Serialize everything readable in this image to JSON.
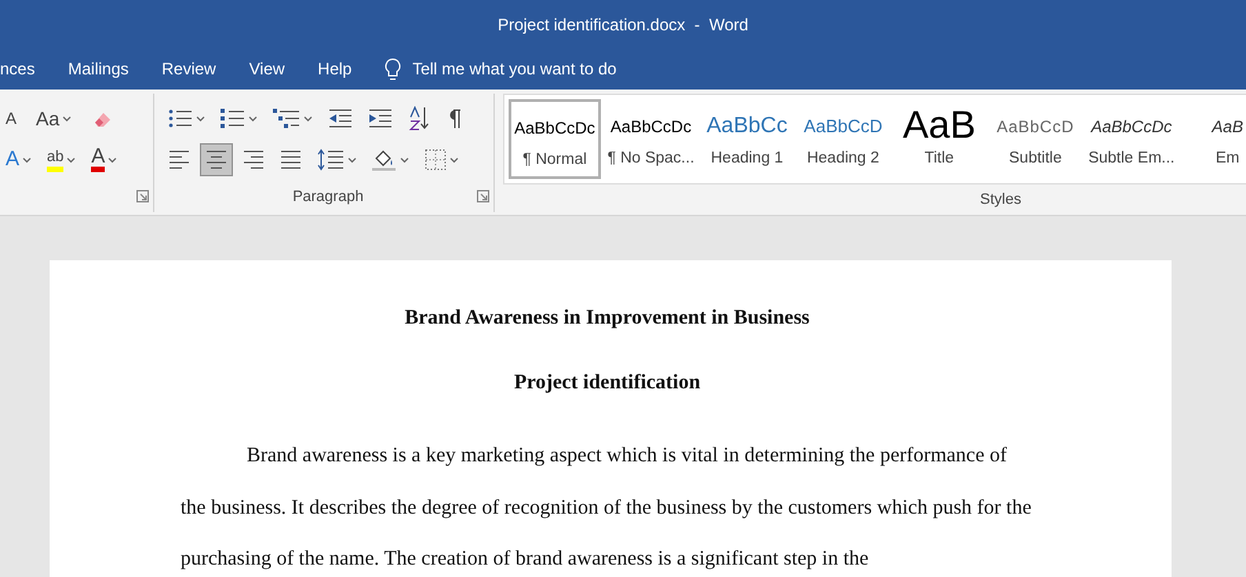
{
  "window": {
    "title": "Project identification.docx  -  Word"
  },
  "ribbon_tabs": [
    {
      "label": "nces"
    },
    {
      "label": "Mailings"
    },
    {
      "label": "Review"
    },
    {
      "label": "View"
    },
    {
      "label": "Help"
    }
  ],
  "tell_me": {
    "placeholder": "Tell me what you want to do"
  },
  "font_group": {
    "row1": [
      {
        "kind": "shrink",
        "label": "A"
      },
      {
        "kind": "case",
        "label": "Aa"
      },
      {
        "kind": "clear"
      }
    ],
    "row2": [
      {
        "kind": "effects",
        "label": "A"
      },
      {
        "kind": "highlight",
        "label": "ab",
        "color": "#ffff00"
      },
      {
        "kind": "fontcolor",
        "label": "A",
        "color": "#e00000"
      }
    ]
  },
  "paragraph_group": {
    "label": "Paragraph",
    "row1": [
      {
        "kind": "bullets"
      },
      {
        "kind": "numbering"
      },
      {
        "kind": "multilevel"
      },
      {
        "kind": "outdent"
      },
      {
        "kind": "indent"
      },
      {
        "kind": "sort"
      },
      {
        "kind": "pilcrow"
      }
    ],
    "alignment": [
      {
        "kind": "left",
        "selected": false
      },
      {
        "kind": "center",
        "selected": true
      },
      {
        "kind": "right",
        "selected": false
      },
      {
        "kind": "justify",
        "selected": false
      }
    ],
    "row2": [
      {
        "kind": "spacing"
      },
      {
        "kind": "shading"
      },
      {
        "kind": "borders"
      }
    ]
  },
  "styles_group": {
    "label": "Styles",
    "styles": [
      {
        "preview": "AaBbCcDc",
        "name": "¶ Normal",
        "kind": "normal",
        "selected": true
      },
      {
        "preview": "AaBbCcDc",
        "name": "¶ No Spac...",
        "kind": "normal",
        "selected": false
      },
      {
        "preview": "AaBbCc",
        "name": "Heading 1",
        "kind": "heading1",
        "selected": false
      },
      {
        "preview": "AaBbCcD",
        "name": "Heading 2",
        "kind": "heading2",
        "selected": false
      },
      {
        "preview": "AaB",
        "name": "Title",
        "kind": "title",
        "selected": false
      },
      {
        "preview": "AaBbCcD",
        "name": "Subtitle",
        "kind": "subtitle",
        "selected": false
      },
      {
        "preview": "AaBbCcDc",
        "name": "Subtle Em...",
        "kind": "emphasis",
        "selected": false
      },
      {
        "preview": "AaB",
        "name": "Em",
        "kind": "emphasis",
        "selected": false
      }
    ]
  },
  "document": {
    "blocks": [
      {
        "kind": "heading",
        "text": "Brand Awareness in Improvement in Business"
      },
      {
        "kind": "heading",
        "text": "Project identification"
      },
      {
        "kind": "paragraph",
        "text": "Brand awareness is a key marketing aspect which is vital in determining the performance of the business. It describes the degree of recognition of the business by the customers which push for the purchasing of the name. The creation of brand awareness is a significant step in the"
      }
    ]
  }
}
